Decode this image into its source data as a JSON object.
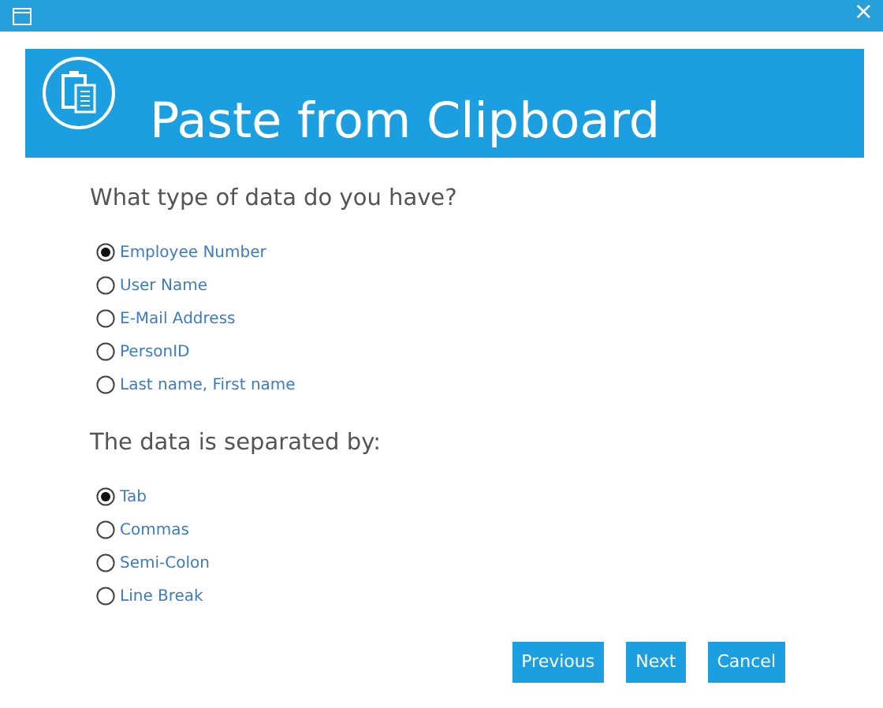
{
  "window": {
    "close_glyph": "×"
  },
  "header": {
    "title": "Paste from Clipboard"
  },
  "groups": [
    {
      "question": "What type of data do you have?",
      "options": [
        {
          "label": "Employee Number",
          "selected": true
        },
        {
          "label": "User Name",
          "selected": false
        },
        {
          "label": "E-Mail Address",
          "selected": false
        },
        {
          "label": "PersonID",
          "selected": false
        },
        {
          "label": "Last name, First name",
          "selected": false
        }
      ]
    },
    {
      "question": "The data is separated by:",
      "options": [
        {
          "label": "Tab",
          "selected": true
        },
        {
          "label": "Commas",
          "selected": false
        },
        {
          "label": "Semi-Colon",
          "selected": false
        },
        {
          "label": "Line Break",
          "selected": false
        }
      ]
    }
  ],
  "buttons": [
    "Previous",
    "Next",
    "Cancel"
  ]
}
